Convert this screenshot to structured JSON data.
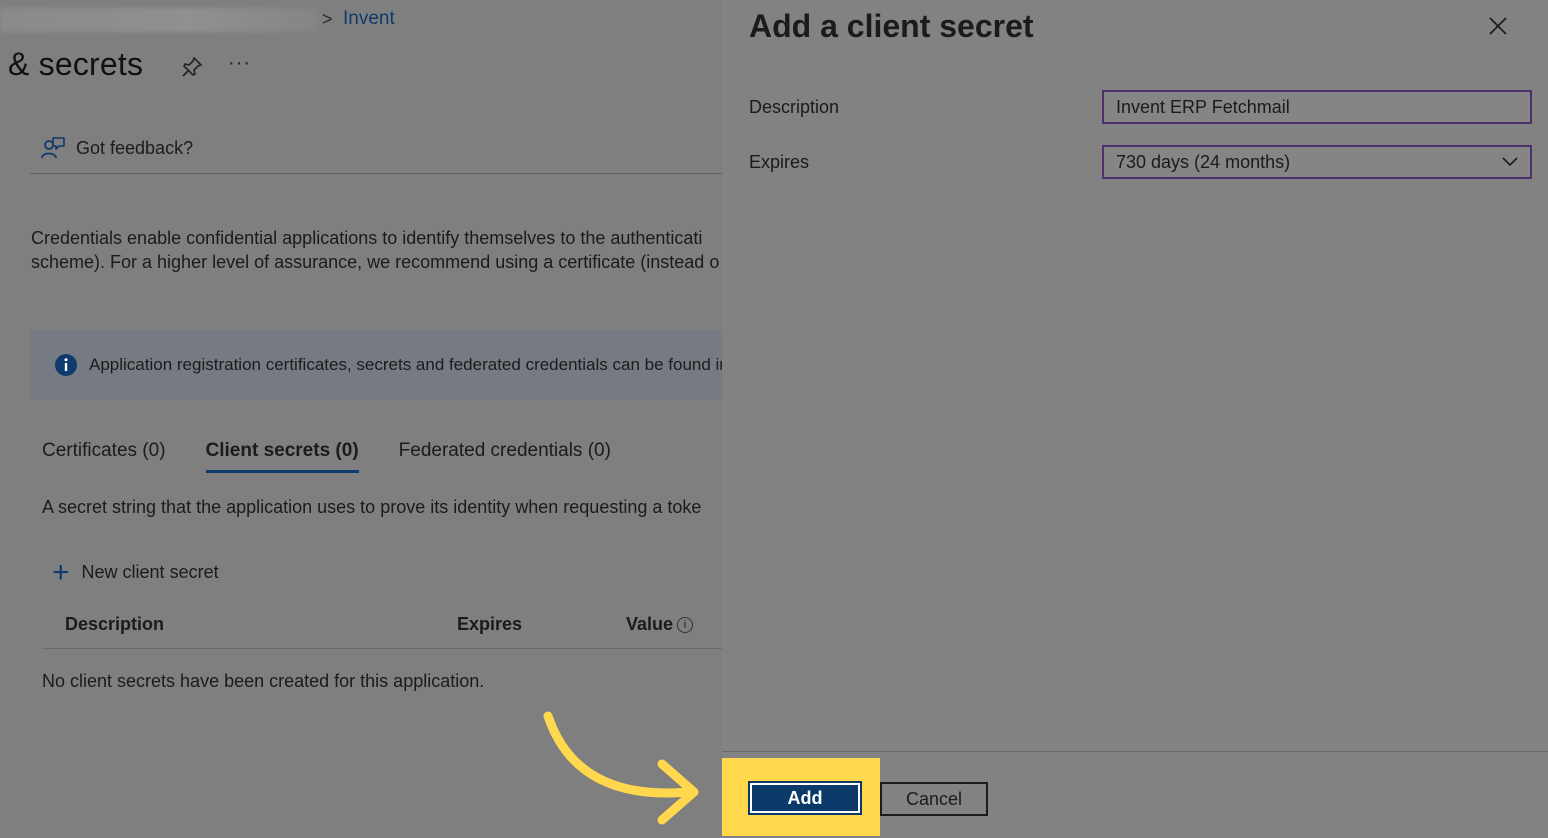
{
  "breadcrumb": {
    "separator": ">",
    "link": "Invent"
  },
  "page": {
    "title": "& secrets",
    "more": "···",
    "feedback": "Got feedback?",
    "description_line1": "Credentials enable confidential applications to identify themselves to the authenticati",
    "description_line2": "scheme). For a higher level of assurance, we recommend using a certificate (instead o",
    "info_text": "Application registration certificates, secrets and federated credentials can be found ir",
    "tabs": [
      "Certificates (0)",
      "Client secrets (0)",
      "Federated credentials (0)"
    ],
    "active_tab": 1,
    "secret_description": "A secret string that the application uses to prove its identity when requesting a toke",
    "new_secret_label": "New client secret",
    "table_headers": [
      "Description",
      "Expires",
      "Value"
    ],
    "empty_message": "No client secrets have been created for this application."
  },
  "panel": {
    "title": "Add a client secret",
    "description_label": "Description",
    "description_value": "Invent ERP Fetchmail",
    "expires_label": "Expires",
    "expires_value": "730 days (24 months)",
    "add_label": "Add",
    "cancel_label": "Cancel"
  },
  "colors": {
    "accent": "#0f3a6e",
    "highlight": "#ffd84d",
    "input_border": "#50306c"
  }
}
